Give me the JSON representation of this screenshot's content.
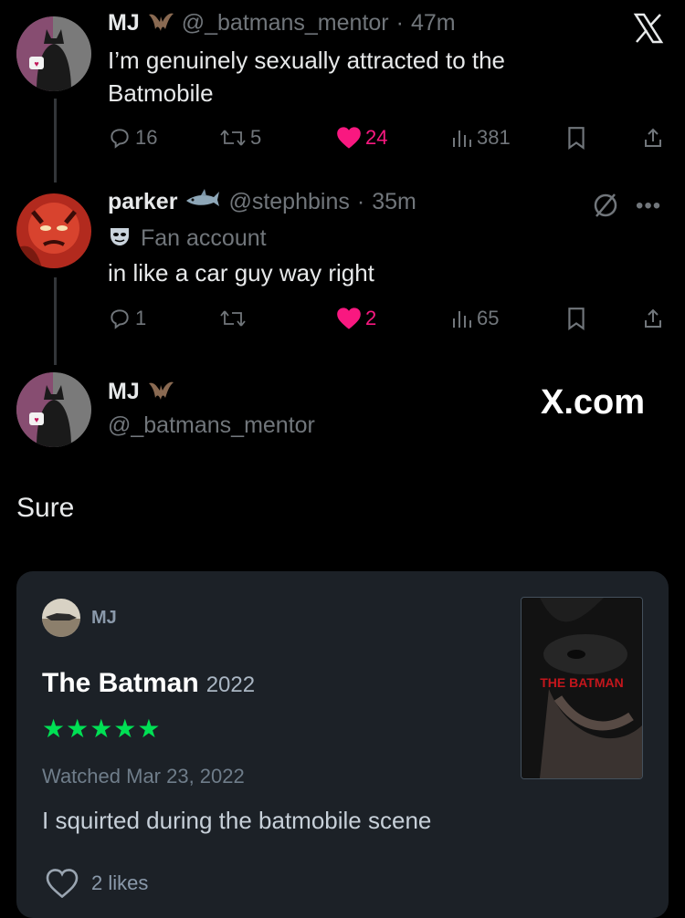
{
  "tweets": [
    {
      "name": "MJ",
      "handle": "@_batmans_mentor",
      "time": "47m",
      "text": "I’m genuinely sexually attracted to the Batmobile",
      "replies": "16",
      "retweets": "5",
      "likes": "24",
      "views": "381"
    },
    {
      "name": "parker",
      "handle": "@stephbins",
      "time": "35m",
      "label": "Fan account",
      "text": "in like a car guy way right",
      "replies": "1",
      "retweets": "",
      "likes": "2",
      "views": "65"
    }
  ],
  "quote": {
    "name": "MJ",
    "handle": "@_batmans_mentor",
    "watermark": "X.com",
    "text": "Sure"
  },
  "review_card": {
    "user": "MJ",
    "film_title": "The Batman",
    "year": "2022",
    "stars": "★★★★★",
    "watched": "Watched Mar 23, 2022",
    "review": "I squirted during the batmobile scene",
    "likes": "2 likes",
    "poster_title": "THE BATMAN"
  },
  "colors": {
    "background": "#000000",
    "like_pink": "#f91880",
    "muted": "#71767b",
    "star_green": "#00e054",
    "card_bg": "#1c2127"
  },
  "icons": [
    "x-logo-icon",
    "bat-emoji-icon",
    "shark-emoji-icon",
    "mask-emoji-icon",
    "reply-icon",
    "retweet-icon",
    "heart-icon",
    "views-icon",
    "bookmark-icon",
    "share-icon",
    "more-icon",
    "no-sign-icon",
    "heart-outline-icon"
  ]
}
